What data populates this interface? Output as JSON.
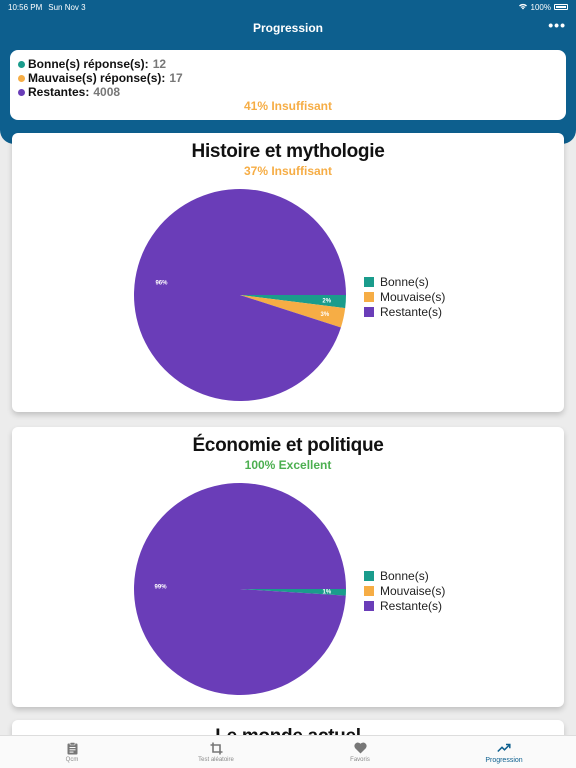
{
  "status": {
    "time": "10:56 PM",
    "date": "Sun Nov 3",
    "battery": "100%"
  },
  "header": {
    "title": "Progression",
    "more": "•••"
  },
  "summary": {
    "rows": [
      {
        "label": "Bonne(s) réponse(s):",
        "value": "12",
        "color": "#1a9c8c"
      },
      {
        "label": "Mauvaise(s) réponse(s):",
        "value": "17",
        "color": "#f6ad45"
      },
      {
        "label": "Restantes:",
        "value": "4008",
        "color": "#6a3db8"
      }
    ],
    "score": "41% Insuffisant"
  },
  "colors": {
    "good": "#1a9c8c",
    "bad": "#f6ad45",
    "remaining": "#6a3db8",
    "insufficient": "#f6ad45",
    "excellent": "#4caf50",
    "brand": "#0d5f8e"
  },
  "cards": [
    {
      "title": "Histoire et mythologie",
      "score": "37% Insuffisant",
      "legend": [
        "Bonne(s)",
        "Mouvaise(s)",
        "Restante(s)"
      ],
      "slice_labels": [
        "2%",
        "3%",
        "96%"
      ]
    },
    {
      "title": "Économie et politique",
      "score": "100% Excellent",
      "legend": [
        "Bonne(s)",
        "Mouvaise(s)",
        "Restante(s)"
      ],
      "slice_labels": [
        "1%",
        "",
        "99%"
      ]
    },
    {
      "title": "Le monde actuel"
    }
  ],
  "chart_data": [
    {
      "type": "pie",
      "title": "Histoire et mythologie",
      "categories": [
        "Bonne(s)",
        "Mouvaise(s)",
        "Restante(s)"
      ],
      "values": [
        2,
        3,
        96
      ]
    },
    {
      "type": "pie",
      "title": "Économie et politique",
      "categories": [
        "Bonne(s)",
        "Mouvaise(s)",
        "Restante(s)"
      ],
      "values": [
        1,
        0,
        99
      ]
    }
  ],
  "tabs": [
    {
      "label": "Qcm",
      "icon": "clipboard-icon"
    },
    {
      "label": "Test aléatoire",
      "icon": "crop-icon"
    },
    {
      "label": "Favoris",
      "icon": "heart-icon"
    },
    {
      "label": "Progression",
      "icon": "trending-up-icon"
    }
  ]
}
